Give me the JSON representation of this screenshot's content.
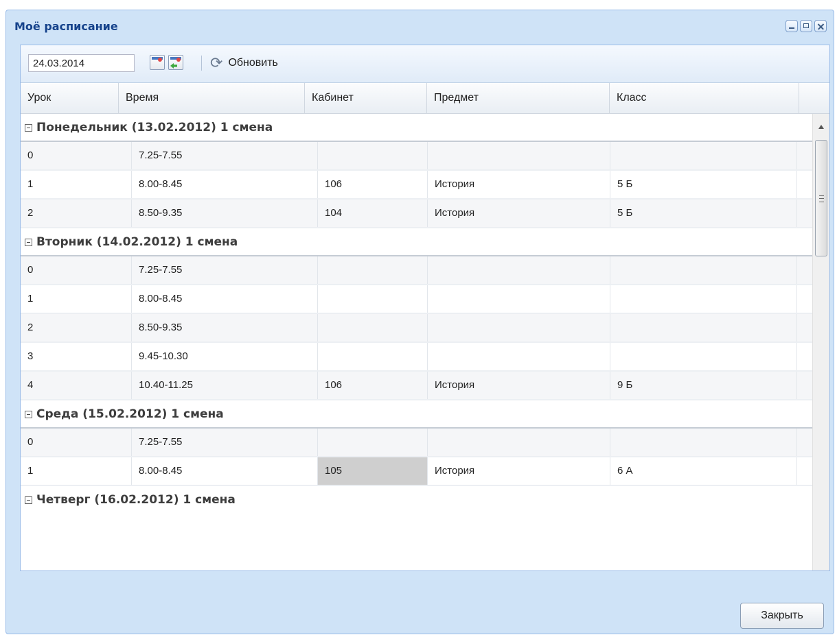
{
  "window": {
    "title": "Моё расписание"
  },
  "toolbar": {
    "date_value": "24.03.2014",
    "refresh_label": "Обновить"
  },
  "columns": [
    "Урок",
    "Время",
    "Кабинет",
    "Предмет",
    "Класс"
  ],
  "groups": [
    {
      "label": "Понедельник (13.02.2012) 1 смена",
      "rows": [
        {
          "lesson": "0",
          "time": "7.25-7.55",
          "room": "",
          "subject": "",
          "class": ""
        },
        {
          "lesson": "1",
          "time": "8.00-8.45",
          "room": "106",
          "subject": "История",
          "class": "5 Б"
        },
        {
          "lesson": "2",
          "time": "8.50-9.35",
          "room": "104",
          "subject": "История",
          "class": "5 Б"
        }
      ]
    },
    {
      "label": "Вторник (14.02.2012) 1 смена",
      "rows": [
        {
          "lesson": "0",
          "time": "7.25-7.55",
          "room": "",
          "subject": "",
          "class": ""
        },
        {
          "lesson": "1",
          "time": "8.00-8.45",
          "room": "",
          "subject": "",
          "class": ""
        },
        {
          "lesson": "2",
          "time": "8.50-9.35",
          "room": "",
          "subject": "",
          "class": ""
        },
        {
          "lesson": "3",
          "time": "9.45-10.30",
          "room": "",
          "subject": "",
          "class": ""
        },
        {
          "lesson": "4",
          "time": "10.40-11.25",
          "room": "106",
          "subject": "История",
          "class": "9 Б"
        }
      ]
    },
    {
      "label": "Среда (15.02.2012) 1 смена",
      "rows": [
        {
          "lesson": "0",
          "time": "7.25-7.55",
          "room": "",
          "subject": "",
          "class": ""
        },
        {
          "lesson": "1",
          "time": "8.00-8.45",
          "room": "105",
          "subject": "История",
          "class": "6 А",
          "selected_cell": "room"
        }
      ]
    },
    {
      "label": "Четверг (16.02.2012) 1 смена",
      "rows": []
    }
  ],
  "footer": {
    "close_label": "Закрыть"
  }
}
